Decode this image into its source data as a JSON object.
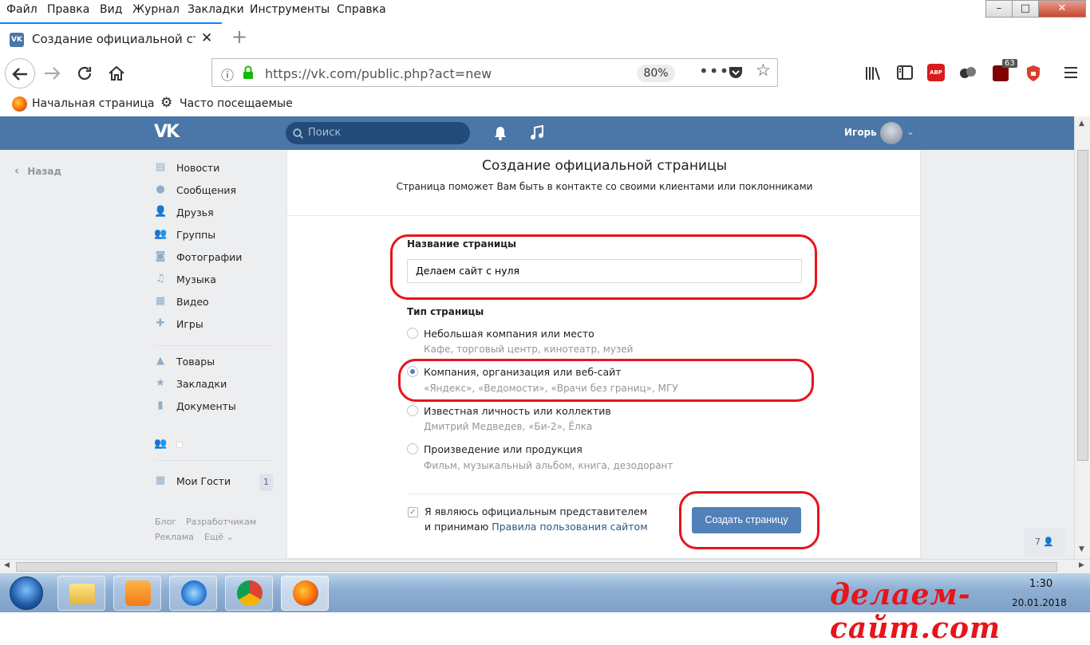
{
  "menu": [
    "Файл",
    "Правка",
    "Вид",
    "Журнал",
    "Закладки",
    "Инструменты",
    "Справка"
  ],
  "window_buttons": [
    "–",
    "□",
    "✕"
  ],
  "tab": {
    "title": "Создание официальной стра",
    "close": "✕",
    "new": "+"
  },
  "nav": {
    "url": "https://vk.com/public.php?act=new",
    "zoom": "80%",
    "badge_count": "63",
    "abp_label": "ABP"
  },
  "bookmarks": [
    "Начальная страница",
    "Часто посещаемые"
  ],
  "vk_header": {
    "logo": "VK",
    "search_placeholder": "Поиск",
    "user": "Игорь"
  },
  "sidebar": {
    "back": "Назад",
    "items": [
      "Новости",
      "Сообщения",
      "Друзья",
      "Группы",
      "Фотографии",
      "Музыка",
      "Видео",
      "Игры"
    ],
    "items2": [
      "Товары",
      "Закладки",
      "Документы"
    ],
    "guests": "Мои Гости",
    "guests_count": "1",
    "footer": [
      "Блог",
      "Разработчикам",
      "Реклама",
      "Ещё ⌄"
    ]
  },
  "card": {
    "title": "Создание официальной страницы",
    "subtitle": "Страница поможет Вам быть в контакте со своими клиентами или поклонниками",
    "name_label": "Название страницы",
    "name_value": "Делаем сайт с нуля",
    "type_label": "Тип страницы",
    "options": [
      {
        "title": "Небольшая компания или место",
        "desc": "Кафе, торговый центр, кинотеатр, музей",
        "selected": false
      },
      {
        "title": "Компания, организация или веб-сайт",
        "desc": "«Яндекс», «Ведомости», «Врачи без границ», МГУ",
        "selected": true
      },
      {
        "title": "Известная личность или коллектив",
        "desc": "Дмитрий Медведев, «Би-2», Ёлка",
        "selected": false
      },
      {
        "title": "Произведение или продукция",
        "desc": "Фильм, музыкальный альбом, книга, дезодорант",
        "selected": false
      }
    ],
    "agree_line1": "Я являюсь официальным представителем",
    "agree_line2": "и принимаю ",
    "agree_link": "Правила пользования сайтом",
    "create_button": "Создать страницу"
  },
  "right_badge": "7",
  "taskbar": {
    "watermark": "делаем-сайт.com",
    "clock": "1:30",
    "date": "20.01.2018"
  },
  "colors": {
    "vk_blue": "#4a76a8",
    "button_blue": "#5181b8",
    "annotation_red": "#e8141b"
  }
}
